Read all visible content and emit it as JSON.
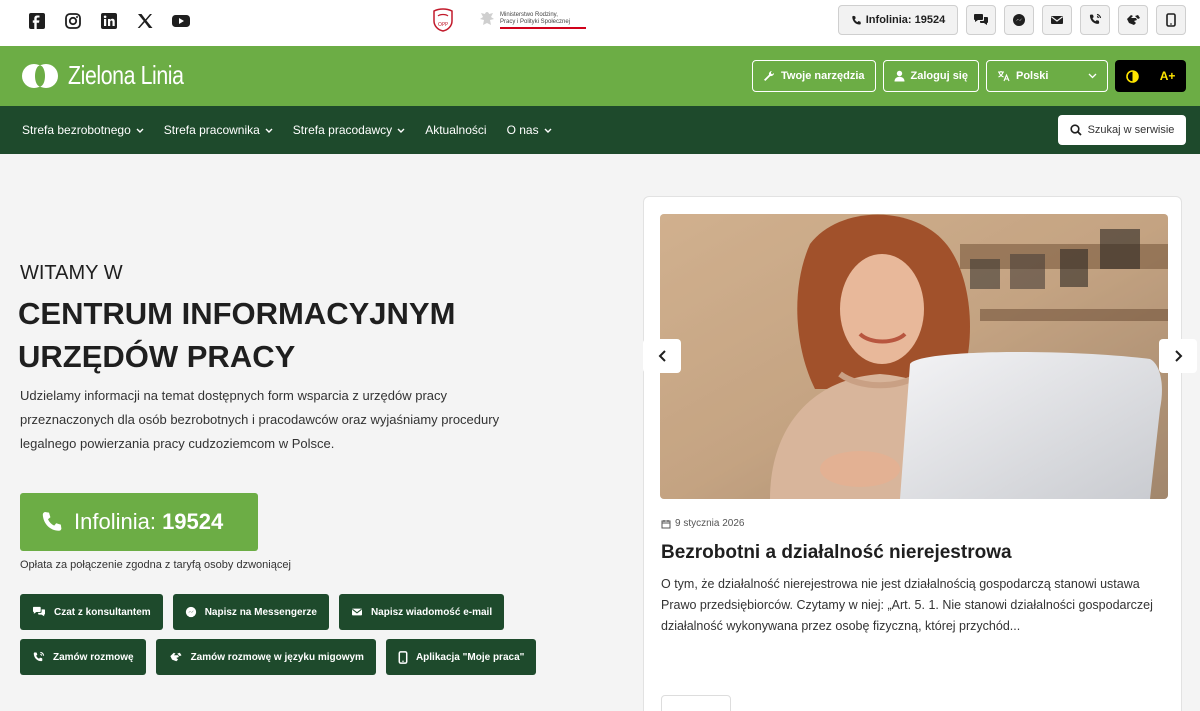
{
  "topbar": {
    "social_icons": [
      "facebook-icon",
      "instagram-icon",
      "linkedin-icon",
      "x-icon",
      "youtube-icon"
    ],
    "logo_opp_label": "OPP",
    "ministry_line1": "Ministerstwo Rodziny,",
    "ministry_line2": "Pracy i Polityki Społecznej",
    "infolinia_label": "Infolinia: 19524",
    "action_icons": [
      "chat-icon",
      "messenger-icon",
      "email-icon",
      "callback-icon",
      "sign-language-icon",
      "mobile-app-icon"
    ]
  },
  "header": {
    "brand": "Zielona Linia",
    "tools_label": "Twoje narzędzia",
    "login_label": "Zaloguj się",
    "language_value": "Polski",
    "contrast_label": "A+"
  },
  "nav": {
    "items": [
      {
        "label": "Strefa bezrobotnego",
        "dropdown": true
      },
      {
        "label": "Strefa pracownika",
        "dropdown": true
      },
      {
        "label": "Strefa pracodawcy",
        "dropdown": true
      },
      {
        "label": "Aktualności",
        "dropdown": false
      },
      {
        "label": "O nas",
        "dropdown": true
      }
    ],
    "search_label": "Szukaj w serwisie"
  },
  "hero": {
    "welcome": "WITAMY W",
    "title_line1": "CENTRUM INFORMACYJNYM",
    "title_line2": "URZĘDÓW PRACY",
    "lead": "Udzielamy informacji na temat dostępnych form wsparcia z urzędów pracy przeznaczonych dla osób bezrobotnych i pracodawców oraz wyjaśniamy procedury legalnego powierzania pracy cudzoziemcom w Polsce.",
    "infolinia_prefix": "Infolinia: ",
    "infolinia_number": "19524",
    "fee_note": "Opłata za połączenie zgodna z taryfą osoby dzwoniącej",
    "contacts_row1": [
      {
        "label": "Czat z konsultantem",
        "icon": "chat-icon"
      },
      {
        "label": "Napisz na Messengerze",
        "icon": "messenger-icon"
      },
      {
        "label": "Napisz wiadomość e-mail",
        "icon": "email-icon"
      }
    ],
    "contacts_row2": [
      {
        "label": "Zamów rozmowę",
        "icon": "callback-icon"
      },
      {
        "label": "Zamów rozmowę w języku migowym",
        "icon": "sign-language-icon"
      },
      {
        "label": "Aplikacja \"Moje praca\"",
        "icon": "mobile-app-icon"
      }
    ]
  },
  "news": {
    "date": "9 stycznia 2026",
    "title": "Bezrobotni a działalność nierejestrowa",
    "excerpt": "O tym, że działalność nierejestrowa nie jest działalnością gospodarczą stanowi ustawa Prawo przedsiębiorców. Czytamy w niej: „Art. 5. 1. Nie stanowi działalności gospodarczej działalność wykonywana przez osobę fizyczną, której przychód..."
  },
  "colors": {
    "brand_green": "#6cad45",
    "dark_green": "#1e4a2c",
    "contrast_black": "#000000",
    "contrast_yellow": "#ffe500"
  }
}
